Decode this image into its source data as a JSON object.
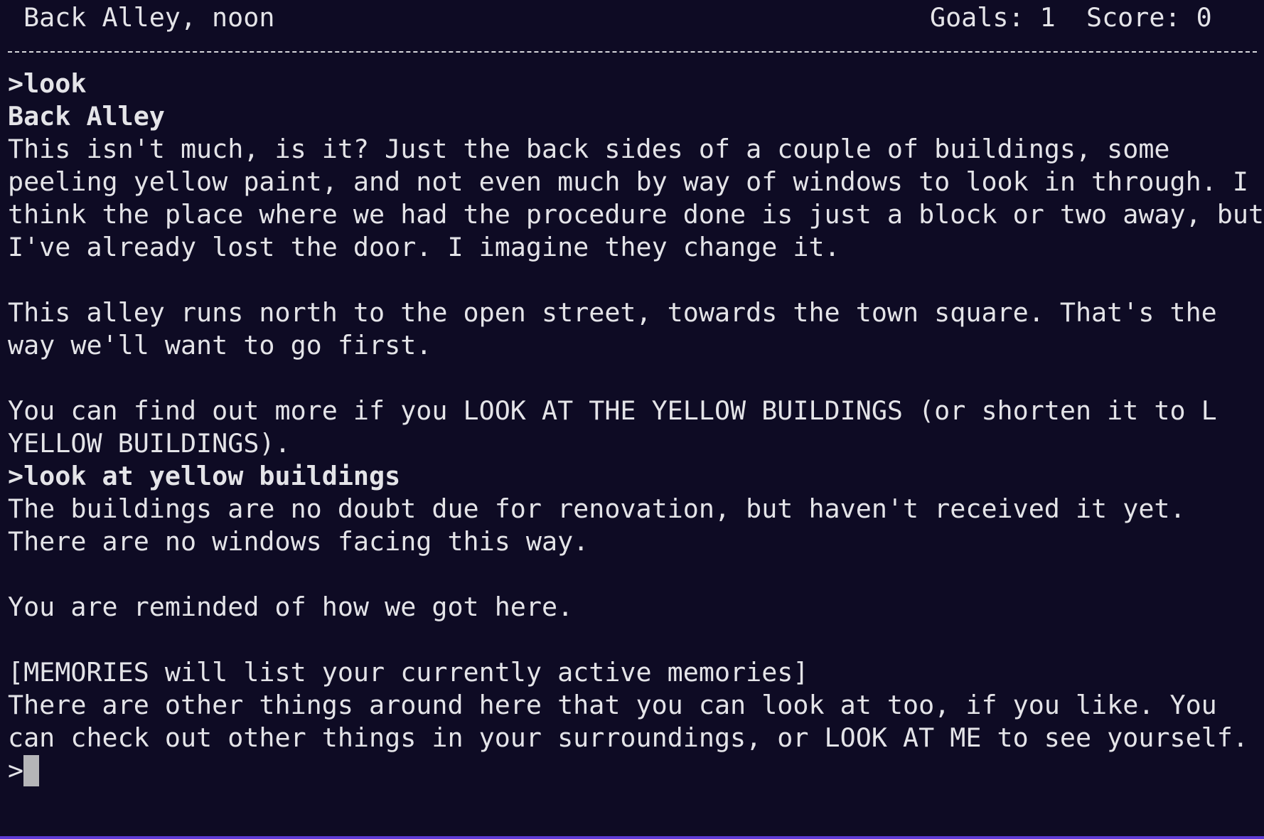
{
  "status_bar": {
    "location": "Back Alley, noon",
    "goals": "Goals: 1",
    "score": "Score: 0"
  },
  "transcript": {
    "cmd1": ">look",
    "room_title": "Back Alley",
    "desc": [
      "This isn't much, is it? Just the back sides of a couple of buildings, some",
      "peeling yellow paint, and not even much by way of windows to look in through. I",
      "think the place where we had the procedure done is just a block or two away, but",
      "I've already lost the door. I imagine they change it."
    ],
    "alley": [
      "This alley runs north to the open street, towards the town square. That's the",
      "way we'll want to go first."
    ],
    "hint": [
      "You can find out more if you LOOK AT THE YELLOW BUILDINGS (or shorten it to L",
      "YELLOW BUILDINGS)."
    ],
    "cmd2": ">look at yellow buildings",
    "buildings": [
      "The buildings are no doubt due for renovation, but haven't received it yet.",
      "There are no windows facing this way."
    ],
    "reminded": "You are reminded of how we got here.",
    "memories": "[MEMORIES will list your currently active memories]",
    "others": [
      "There are other things around here that you can look at too, if you like. You",
      "can check out other things in your surroundings, or LOOK AT ME to see yourself."
    ],
    "prompt": ">"
  },
  "colors": {
    "background": "#0e0b24",
    "text": "#e4e4e8",
    "cursor": "#b5b5b8",
    "window_border": "#5e3bd6"
  }
}
